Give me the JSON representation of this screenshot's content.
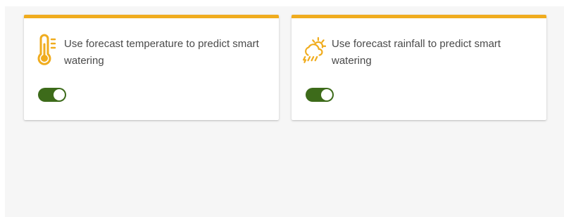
{
  "theme": {
    "accent": "#f0ac1e",
    "toggle_on": "#3d6b1a",
    "panel_bg": "#f6f6f6",
    "text": "#4a4a4a"
  },
  "cards": [
    {
      "icon": "thermometer-icon",
      "description": "Use forecast temperature to predict smart watering",
      "toggle_on": true
    },
    {
      "icon": "sun-cloud-rain-icon",
      "description": "Use forecast rainfall to predict smart watering",
      "toggle_on": true
    }
  ]
}
